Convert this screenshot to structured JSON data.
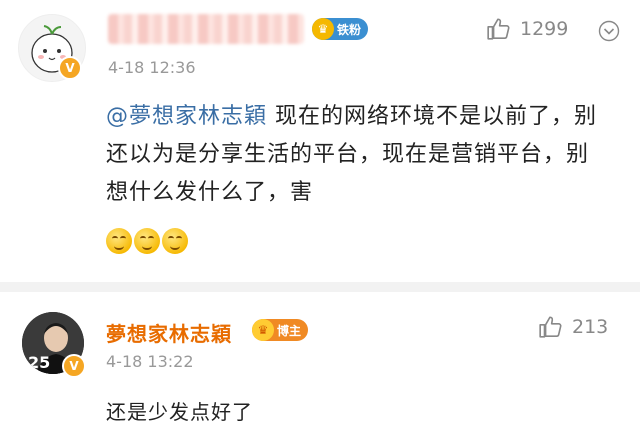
{
  "comments": [
    {
      "username_blurred": true,
      "fan_badge": {
        "label": "铁粉",
        "color": "#3b8fd1"
      },
      "time": "4-18 12:36",
      "like_count": "1299",
      "mention": "@夢想家林志穎",
      "text": " 现在的网络环境不是以前了，别还以为是分享生活的平台，现在是营销平台，别想什么发什么了，害",
      "emoji_icons": [
        "smile-emoji-icon",
        "smile-emoji-icon",
        "smile-emoji-icon"
      ]
    },
    {
      "username": "夢想家林志穎",
      "fan_badge": {
        "label": "博主",
        "color": "#f08a24"
      },
      "time": "4-18 13:22",
      "like_count": "213",
      "avatar_label": "25",
      "text": "还是少发点好了"
    }
  ],
  "colors": {
    "name_orange": "#e86c00",
    "mention_blue": "#3a6ea5",
    "meta_gray": "#999999",
    "divider": "#f2f2f2"
  }
}
